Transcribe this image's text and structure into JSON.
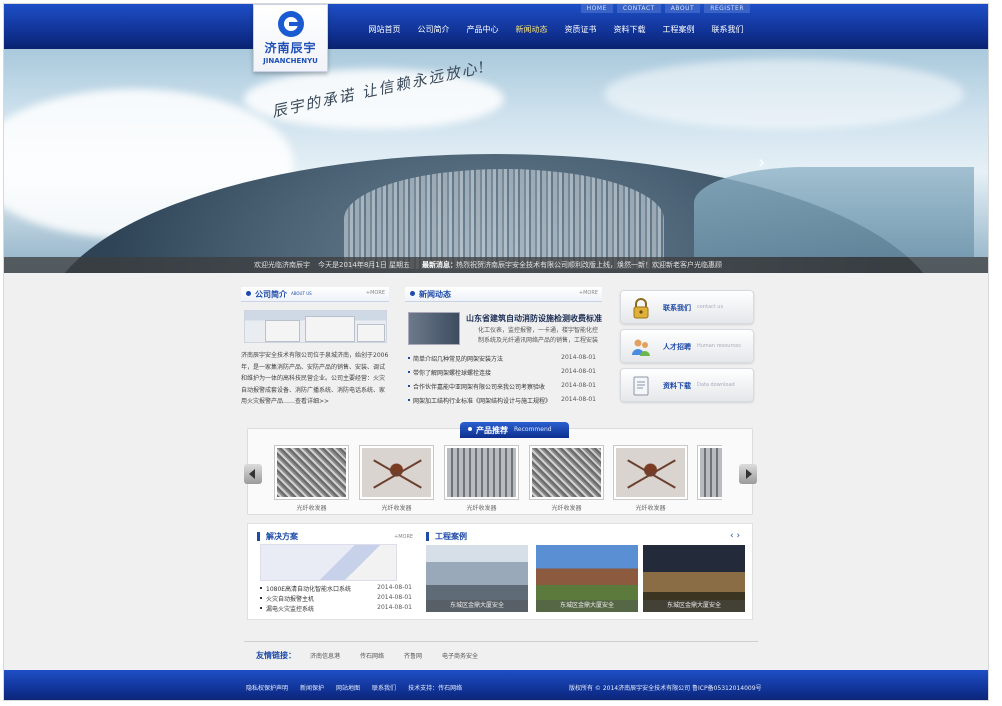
{
  "top_links": [
    "HOME",
    "CONTACT",
    "ABOUT",
    "REGISTER"
  ],
  "main_nav": [
    {
      "label": "网站首页",
      "active": false
    },
    {
      "label": "公司简介",
      "active": false
    },
    {
      "label": "产品中心",
      "active": false
    },
    {
      "label": "新闻动态",
      "active": true
    },
    {
      "label": "资质证书",
      "active": false
    },
    {
      "label": "资料下载",
      "active": false
    },
    {
      "label": "工程案例",
      "active": false
    },
    {
      "label": "联系我们",
      "active": false
    }
  ],
  "logo": {
    "cn": "济南辰宇",
    "en": "JINANCHENYU"
  },
  "banner": {
    "slogan": "辰宇的承诺  让信赖永远放心!",
    "welcome": "欢迎光临济南辰宇",
    "date": "今天是2014年8月1日  星期五",
    "news_label": "最新消息：",
    "news_text": "热烈祝贺济南辰宇安全技术有限公司顺利改版上线，焕然一新！欢迎新老客户光临惠顾"
  },
  "about": {
    "title": "公司简介",
    "subtitle": "ABOUT US",
    "more": "+MORE",
    "text": "济南辰宇安全技术有限公司位于泉城济南，始创于2006年，是一家集消防产品、安防产品的销售、安装、调试和维护为一体的高科技民营企业。公司主要经营：火灾自动报警成套设备、消防广播系统、消防电话系统、家用火灾报警产品……查看详细>>"
  },
  "news": {
    "title": "新闻动态",
    "more": "+MORE",
    "headline": "山东省建筑自动消防设施检测收费标准",
    "summary": "化工仪表，监控报警，一卡通，楼宇智能化控制系统及光纤通讯网络产品的销售，工程安装",
    "items": [
      {
        "title": "简单介绍几种常见的网架安装方法",
        "date": "2014-08-01"
      },
      {
        "title": "带你了解网架螺栓球螺栓连接",
        "date": "2014-08-01"
      },
      {
        "title": "合作伙伴嘉能中亚网架有限公司来我公司考察验收",
        "date": "2014-08-01"
      },
      {
        "title": "网架加工结构行业标准《网架结构设计与施工规程》",
        "date": "2014-08-01"
      }
    ]
  },
  "side_buttons": [
    {
      "label": "联系我们",
      "en": "contact us",
      "icon": "lock-icon"
    },
    {
      "label": "人才招聘",
      "en": "Human resources",
      "icon": "people-icon"
    },
    {
      "label": "资料下载",
      "en": "Data download",
      "icon": "document-icon"
    }
  ],
  "products": {
    "title": "产品推荐",
    "title_en": "Recommend",
    "items": [
      {
        "name": "光纤收发器",
        "style": "coil"
      },
      {
        "name": "光纤收发器",
        "style": "spider"
      },
      {
        "name": "光纤收发器",
        "style": "tiles"
      },
      {
        "name": "光纤收发器",
        "style": "coil"
      },
      {
        "name": "光纤收发器",
        "style": "spider"
      }
    ]
  },
  "solutions": {
    "title": "解决方案",
    "more": "+MORE",
    "items": [
      {
        "title": "1080E高清自动化智能水口系统",
        "date": "2014-08-01"
      },
      {
        "title": "火灾自动报警主机",
        "date": "2014-08-01"
      },
      {
        "title": "漏电火灾监控系统",
        "date": "2014-08-01"
      }
    ]
  },
  "cases": {
    "title": "工程案例",
    "items": [
      {
        "caption": "东城区金鼎大厦安全"
      },
      {
        "caption": "东城区金鼎大厦安全"
      },
      {
        "caption": "东城区金鼎大厦安全"
      }
    ]
  },
  "friend_links": {
    "label": "友情链接：",
    "items": [
      "济南信息港",
      "传石网络",
      "齐鲁网",
      "电子商务安全"
    ]
  },
  "footer": {
    "nav": [
      "隐私权保护声明",
      "新闻保护",
      "网站地图",
      "联系我们",
      "技术支持：传石网络"
    ],
    "copyright": "版权所有 © 2014济南辰宇安全技术有限公司 鲁ICP备05312014009号"
  },
  "colors": {
    "brand_blue": "#0f2f8f",
    "accent_blue": "#1e4aa8",
    "active_nav": "#f7e27a"
  }
}
